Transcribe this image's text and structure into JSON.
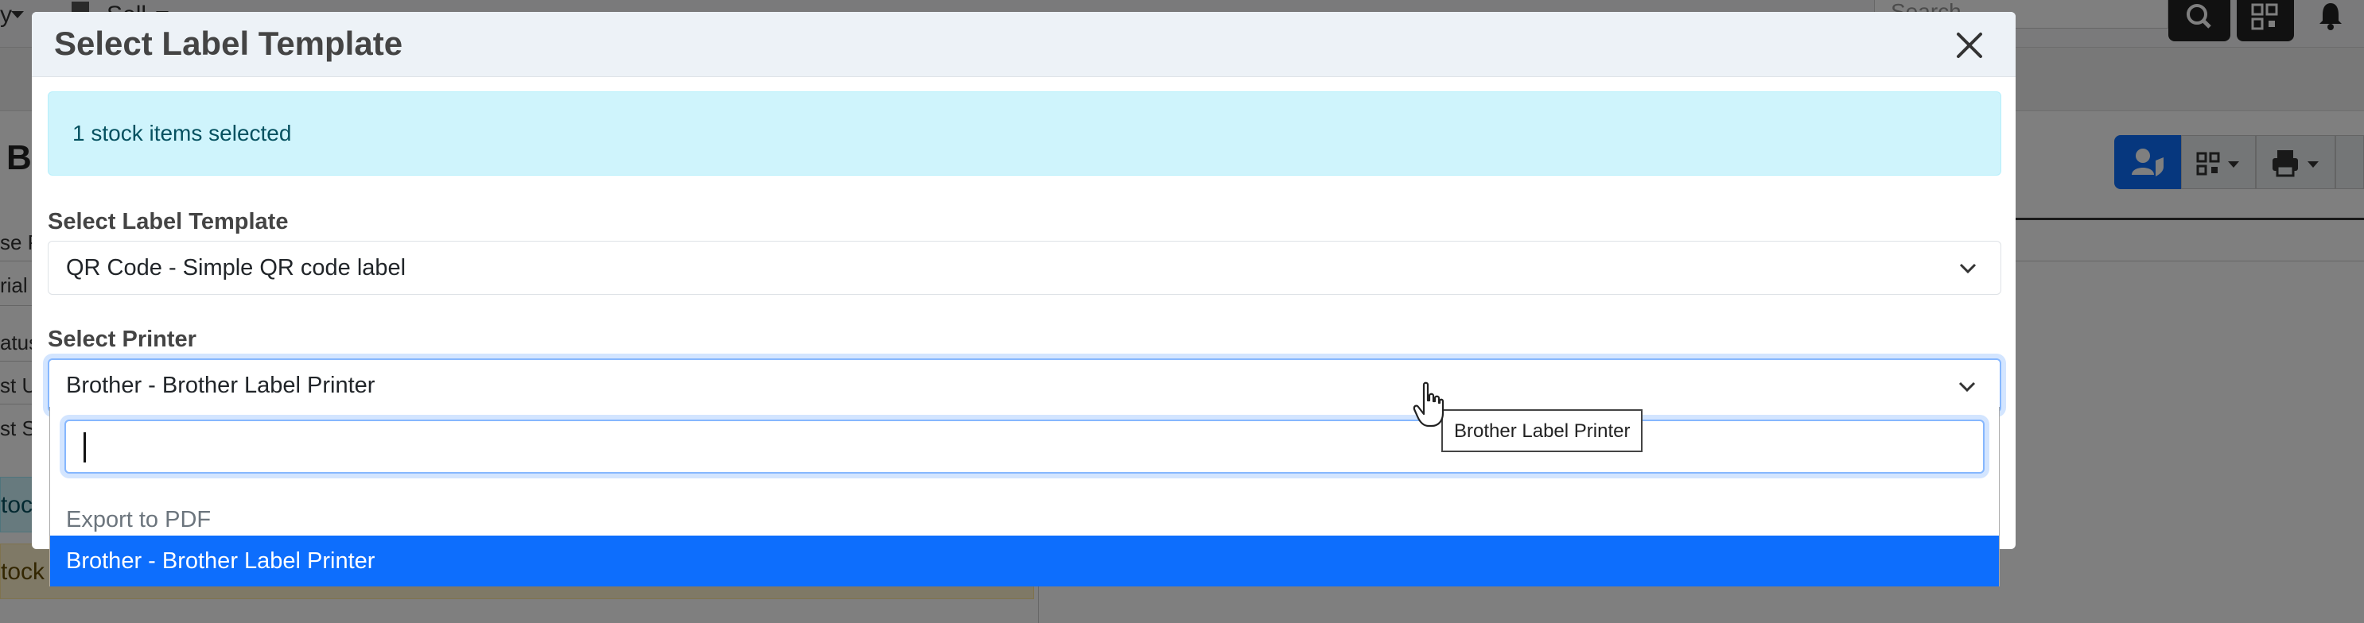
{
  "background": {
    "nav_left_text": "y",
    "nav_sell_label": "Sell",
    "search_placeholder": "Search",
    "page_title_fragment": "Bl",
    "left_labels": [
      "se P",
      "rial",
      "atus",
      "st U",
      "st S"
    ],
    "alert_cyan_fragment": "toc",
    "alert_yellow_fragment": "tock"
  },
  "modal": {
    "title": "Select Label Template",
    "close_icon": "close-icon",
    "info_message": "1 stock items selected",
    "template_field": {
      "label": "Select Label Template",
      "value": "QR Code - Simple QR code label"
    },
    "printer_field": {
      "label": "Select Printer",
      "value": "Brother - Brother Label Printer"
    },
    "dropdown": {
      "search_value": "",
      "options": [
        {
          "label": "Export to PDF",
          "state": "disabled"
        },
        {
          "label": "Brother - Brother Label Printer",
          "state": "highlighted"
        }
      ]
    }
  },
  "tooltip": {
    "text": "Brother Label Printer"
  },
  "colors": {
    "primary": "#0d6efd",
    "info_bg": "#cff4fc",
    "info_text": "#055160",
    "modal_header_bg": "#edf2f7"
  }
}
